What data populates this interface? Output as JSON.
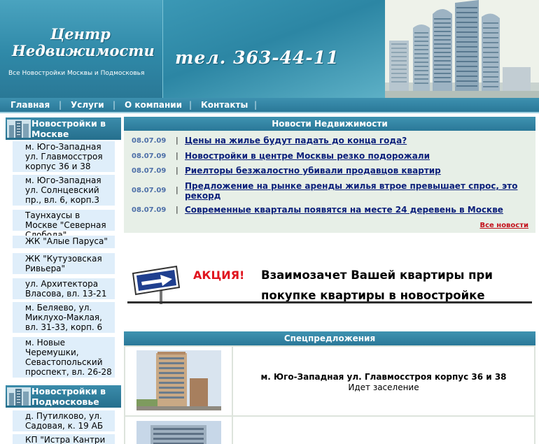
{
  "header": {
    "logo_line1": "Центр",
    "logo_line2": "Недвижимости",
    "tagline": "Все Новостройки Москвы и Подмосковья",
    "phone": "тел. 363-44-11"
  },
  "nav": {
    "items": [
      "Главная",
      "Услуги",
      "О компании",
      "Контакты"
    ],
    "separator": "|"
  },
  "sidebar": {
    "moscow": {
      "title": "Новостройки в Москве",
      "items": [
        "м. Юго-Западная ул. Главмосстроя корпус 36 и 38",
        "м. Юго-Западная ул. Солнцевский пр., вл. 6, корп.3",
        "Таунхаусы в Москве \"Северная Слобода\"",
        "ЖК \"Алые Паруса\"",
        "ЖК \"Кутузовская Ривьера\"",
        "ул. Архитектора Власова, вл. 13-21",
        "м. Беляево, ул. Миклухо-Маклая, вл. 31-33, корп. 6",
        "м. Новые Черемушки, Севастопольский проспект, вл. 26-28"
      ]
    },
    "region": {
      "title": "Новостройки в Подмосковье",
      "items": [
        "д. Путилково, ул. Садовая, к. 19 АБ",
        "КП \"Истра Кантри"
      ]
    }
  },
  "news": {
    "title": "Новости Недвижимости",
    "items": [
      {
        "date": "08.07.09",
        "text": "Цены на жилье будут падать до конца года?"
      },
      {
        "date": "08.07.09",
        "text": "Новостройки в центре Москвы резко подорожали"
      },
      {
        "date": "08.07.09",
        "text": "Риелторы безжалостно убивали продавцов квартир"
      },
      {
        "date": "08.07.09",
        "text": "Предложение на рынке аренды жилья втрое превышает спрос, это рекорд"
      },
      {
        "date": "08.07.09",
        "text": "Современные кварталы появятся на месте 24 деревень в Москве"
      }
    ],
    "all_link": "Все новости"
  },
  "banner": {
    "tag": "АКЦИЯ!",
    "line1": "Взаимозачет Вашей квартиры при",
    "line2": "покупке квартиры в новостройке"
  },
  "special": {
    "title": "Спецпредложения",
    "offers": [
      {
        "name": "м. Юго-Западная ул. Главмосстроя корпус 36 и 38",
        "status": "Идет заселение"
      }
    ]
  },
  "colors": {
    "header_blue": "#2f89a8",
    "nav_blue": "#2a7898",
    "link_navy": "#0a1f7a",
    "date_blue": "#4d6fa8",
    "accent_red": "#e0141e",
    "sidebar_item_bg": "#dfeefa"
  }
}
